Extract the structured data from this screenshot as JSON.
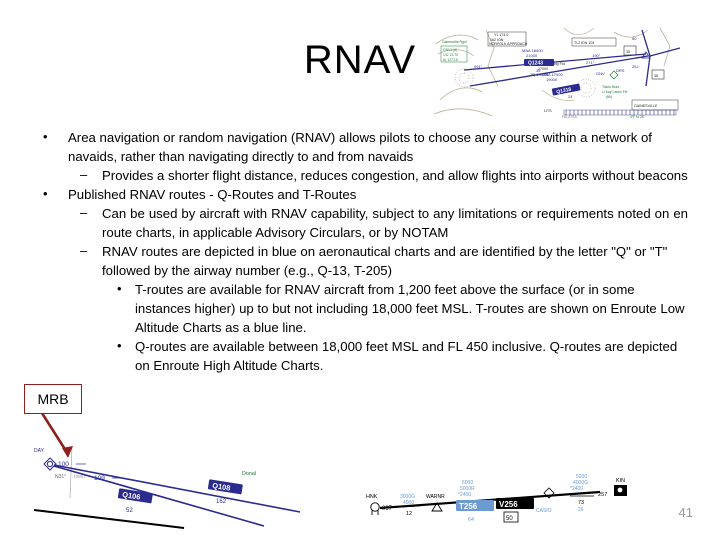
{
  "slide": {
    "title": "RNAV",
    "page_number": "41",
    "background_color": "#ffffff",
    "text_color": "#000000"
  },
  "content": {
    "bullets": [
      {
        "level": 1,
        "marker": "•",
        "text": "Area navigation or random navigation (RNAV) allows pilots to choose any course within a network of navaids, rather than navigating directly to and from navaids",
        "justify": false
      },
      {
        "level": 2,
        "marker": "–",
        "text": "Provides a shorter flight distance, reduces congestion, and allow flights into airports without beacons",
        "justify": true
      },
      {
        "level": 1,
        "marker": "•",
        "text": "Published RNAV routes - Q-Routes and T-Routes",
        "justify": false
      },
      {
        "level": 2,
        "marker": "–",
        "text": "Can be used by aircraft with RNAV capability, subject to any limitations or requirements noted on en route charts, in applicable Advisory Circulars, or by NOTAM",
        "justify": true
      },
      {
        "level": 2,
        "marker": "–",
        "text": "RNAV routes are depicted in blue on aeronautical charts and are identified by the letter \"Q\" or \"T\" followed by the airway number (e.g., Q-13, T-205)",
        "justify": false
      },
      {
        "level": 3,
        "marker": "•",
        "text": "T-routes are available for RNAV aircraft from 1,200 feet above the surface (or in some instances higher) up to but not including 18,000 feet MSL. T-routes are shown on Enroute Low Altitude Charts as a blue line.",
        "justify": false
      },
      {
        "level": 3,
        "marker": "•",
        "text": "Q-routes are available between 18,000 feet MSL and FL 450 inclusive. Q-routes are depicted on Enroute High Altitude Charts.",
        "justify": false
      }
    ]
  },
  "callout": {
    "label": "MRB",
    "border_color": "#8f2020",
    "arrow_color": "#8f2020"
  },
  "charts": {
    "top": {
      "name": "enroute-high-altitude-chart-excerpt",
      "route_color": "#2b2b8f",
      "terrain_color": "#b9ad93",
      "green_color": "#1d7a36",
      "labels": [
        "Y1 174.0",
        "162 ION",
        "NORFOLK  APPROACH",
        "MAA 18000",
        "21000",
        "Q1243",
        "35",
        "091°",
        "271°",
        "Tl-2 IDN  104",
        "190°",
        "35",
        "38",
        "GAINESVILLE",
        "CARB",
        "GNV",
        "DRS",
        "MAA 17000",
        "19000",
        "Q1318",
        "24",
        "28",
        "22",
        "34",
        "Melrose Landing Fld",
        "27000",
        "Tolulu Muni",
        "Lt Kay Larkin Fld",
        "(86)",
        "PALATKA",
        "LITS",
        "Gainesville Rgnl",
        "GNV1",
        "132  13.70",
        "A) 127.15"
      ]
    },
    "bottom_left": {
      "name": "enroute-high-altitude-chart-q-routes",
      "route_color": "#2b2b8f",
      "labels": [
        "DAY",
        "100",
        "109",
        "N31°",
        "Q106",
        "52",
        "Q108",
        "162",
        "Donal"
      ]
    },
    "bottom_right": {
      "name": "enroute-low-altitude-chart-t-routes",
      "t_route_color": "#6c9bd2",
      "v_route_color": "#000000",
      "labels": [
        "HNK",
        "097",
        "3000G",
        "4000",
        "12",
        "WARNR",
        "6000",
        "5000R",
        "*2400",
        "T256",
        "V256",
        "64",
        "50",
        "CASIO",
        "5200",
        "4000G",
        "*2400",
        "73",
        "26",
        "257",
        "KIN"
      ]
    }
  }
}
